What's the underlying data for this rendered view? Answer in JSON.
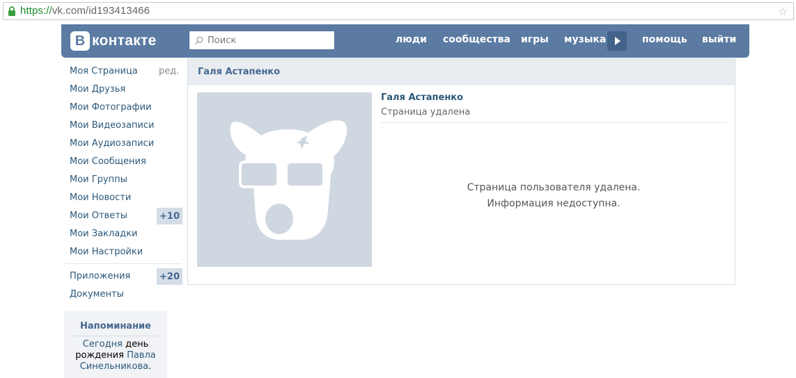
{
  "browser": {
    "url_protocol": "https://",
    "url_rest": "vk.com/id193413466",
    "star_icon": "star-icon"
  },
  "header": {
    "logo_letter": "В",
    "logo_text": "контакте",
    "search_placeholder": "Поиск",
    "nav": [
      "люди",
      "сообщества",
      "игры",
      "музыка",
      "помощь",
      "выйти"
    ],
    "bg_color": "#5b7ba2"
  },
  "sidebar": {
    "items": [
      {
        "label": "Моя Страница",
        "extra": "ред."
      },
      {
        "label": "Мои Друзья"
      },
      {
        "label": "Мои Фотографии"
      },
      {
        "label": "Мои Видеозаписи"
      },
      {
        "label": "Мои Аудиозаписи"
      },
      {
        "label": "Мои Сообщения"
      },
      {
        "label": "Мои Группы"
      },
      {
        "label": "Мои Новости"
      },
      {
        "label": "Мои Ответы",
        "badge": "+10"
      },
      {
        "label": "Мои Закладки"
      },
      {
        "label": "Мои Настройки"
      },
      {
        "label": "Приложения",
        "badge": "+20"
      },
      {
        "label": "Документы"
      }
    ]
  },
  "reminder": {
    "title": "Напоминание",
    "today": "Сегодня",
    "text_mid": "день рождения",
    "person": "Павла Синельникова",
    "end": "."
  },
  "profile": {
    "header_name": "Галя Астапенко",
    "name": "Галя Астапенко",
    "status": "Страница удалена",
    "message_line1": "Страница пользователя удалена.",
    "message_line2": "Информация недоступна."
  }
}
